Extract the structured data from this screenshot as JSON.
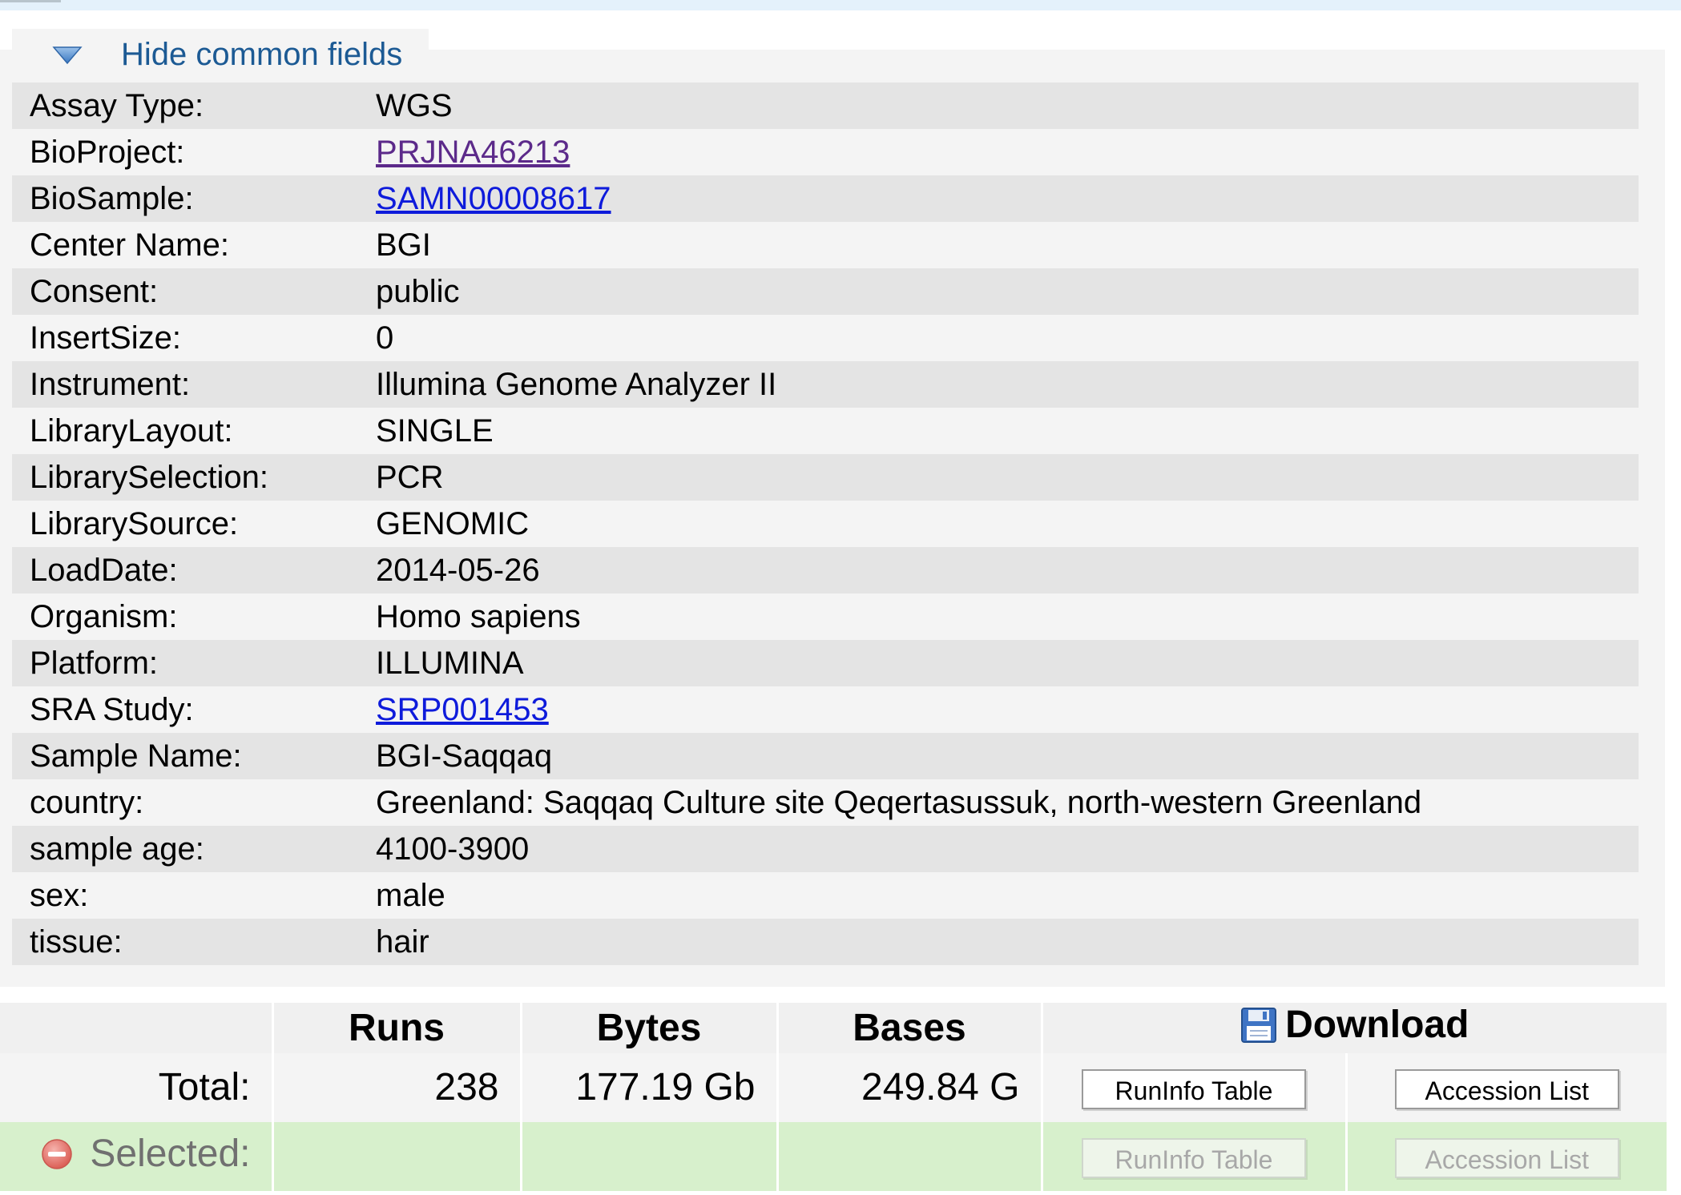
{
  "legend": {
    "toggle_label": "Hide common fields",
    "toggle_icon": "triangle-down-icon"
  },
  "fields": [
    {
      "label": "Assay Type:",
      "value": "WGS"
    },
    {
      "label": "BioProject:",
      "value": "PRJNA46213",
      "link": true,
      "visited": true
    },
    {
      "label": "BioSample:",
      "value": "SAMN00008617",
      "link": true
    },
    {
      "label": "Center Name:",
      "value": "BGI"
    },
    {
      "label": "Consent:",
      "value": "public"
    },
    {
      "label": "InsertSize:",
      "value": "0"
    },
    {
      "label": "Instrument:",
      "value": "Illumina Genome Analyzer II"
    },
    {
      "label": "LibraryLayout:",
      "value": "SINGLE"
    },
    {
      "label": "LibrarySelection:",
      "value": "PCR"
    },
    {
      "label": "LibrarySource:",
      "value": "GENOMIC"
    },
    {
      "label": "LoadDate:",
      "value": "2014-05-26"
    },
    {
      "label": "Organism:",
      "value": "Homo sapiens"
    },
    {
      "label": "Platform:",
      "value": "ILLUMINA"
    },
    {
      "label": "SRA Study:",
      "value": "SRP001453",
      "link": true
    },
    {
      "label": "Sample Name:",
      "value": "BGI-Saqqaq"
    },
    {
      "label": "country:",
      "value": "Greenland: Saqqaq Culture site Qeqertasussuk, north-western Greenland"
    },
    {
      "label": "sample age:",
      "value": "4100-3900"
    },
    {
      "label": "sex:",
      "value": "male"
    },
    {
      "label": "tissue:",
      "value": "hair"
    }
  ],
  "summary": {
    "headers": {
      "runs": "Runs",
      "bytes": "Bytes",
      "bases": "Bases",
      "download": "Download"
    },
    "total": {
      "label": "Total:",
      "runs": "238",
      "bytes": "177.19 Gb",
      "bases": "249.84 G",
      "runinfo_button": "RunInfo Table",
      "accession_button": "Accession List"
    },
    "selected": {
      "label": "Selected:",
      "runinfo_button": "RunInfo Table",
      "accession_button": "Accession List"
    }
  },
  "colors": {
    "link": "#0e1bdb",
    "link_visited": "#5c2a8a",
    "legend_text": "#1c5a94",
    "selected_row_bg": "#d7f0cc"
  }
}
